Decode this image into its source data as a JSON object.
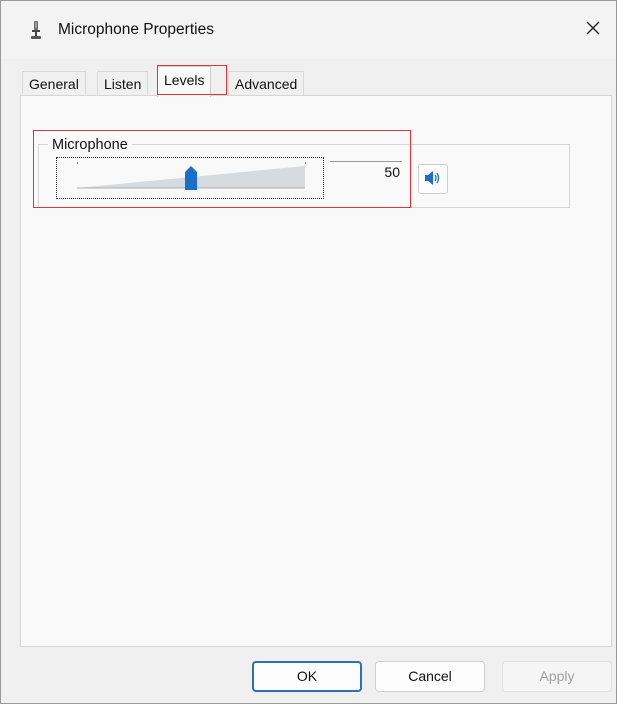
{
  "window": {
    "title": "Microphone Properties",
    "title_icon": "microphone-icon",
    "close_icon": "close-icon",
    "close_glyph": "✕"
  },
  "tabs": [
    {
      "label": "General",
      "active": false
    },
    {
      "label": "Listen",
      "active": false
    },
    {
      "label": "Levels",
      "active": true
    },
    {
      "label": "Advanced",
      "active": false
    }
  ],
  "levels": {
    "group_label": "Microphone",
    "slider_value": 50,
    "slider_max": 100,
    "value_text": "50",
    "mute_icon": "speaker-icon"
  },
  "buttons": {
    "ok": "OK",
    "cancel": "Cancel",
    "apply": "Apply"
  },
  "colors": {
    "accent": "#1a6fc9",
    "highlight": "#d9363e"
  }
}
